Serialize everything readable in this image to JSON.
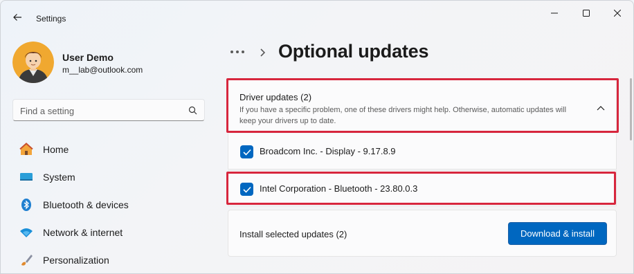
{
  "window": {
    "title": "Settings",
    "accent": "#0067c0",
    "highlight_color": "#d7263d"
  },
  "user": {
    "name": "User Demo",
    "email": "m__lab@outlook.com"
  },
  "search": {
    "placeholder": "Find a setting",
    "value": ""
  },
  "sidebar": {
    "items": [
      {
        "label": "Home",
        "icon": "home-icon"
      },
      {
        "label": "System",
        "icon": "system-icon"
      },
      {
        "label": "Bluetooth & devices",
        "icon": "bluetooth-icon"
      },
      {
        "label": "Network & internet",
        "icon": "wifi-icon"
      },
      {
        "label": "Personalization",
        "icon": "brush-icon"
      }
    ]
  },
  "main": {
    "breadcrumb_more": "•••",
    "page_title": "Optional updates",
    "driver_section": {
      "title": "Driver updates (2)",
      "description": "If you have a specific problem, one of these drivers might help. Otherwise, automatic updates will keep your drivers up to date.",
      "expanded": true
    },
    "drivers": [
      {
        "label": "Broadcom Inc. - Display - 9.17.8.9",
        "checked": true
      },
      {
        "label": "Intel Corporation - Bluetooth - 23.80.0.3",
        "checked": true
      }
    ],
    "install": {
      "label": "Install selected updates (2)",
      "button": "Download & install"
    }
  }
}
